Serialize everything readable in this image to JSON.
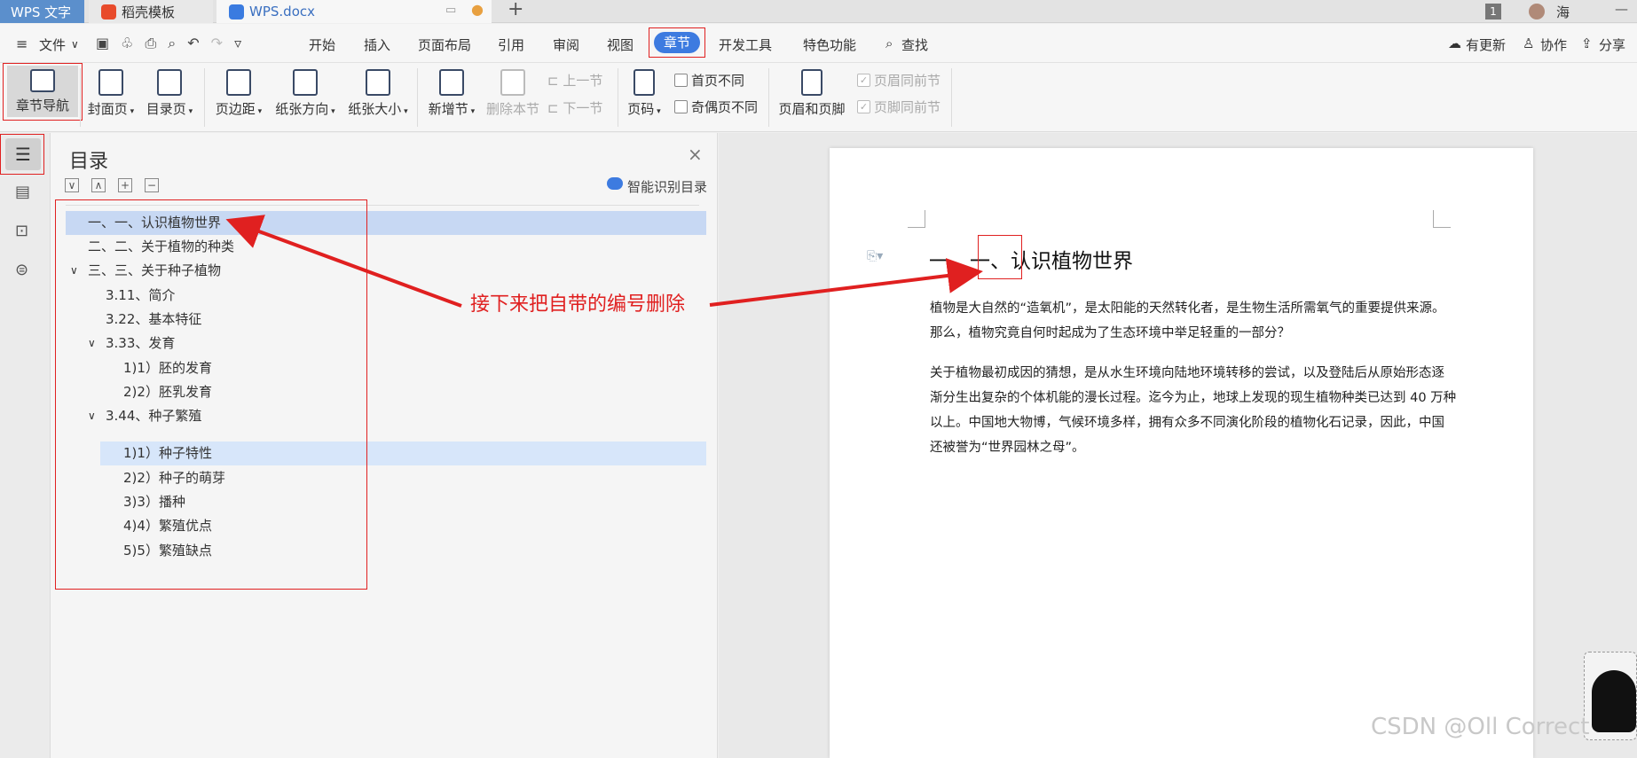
{
  "tabs": [
    {
      "label": "WPS 文字"
    },
    {
      "label": "稻壳模板"
    },
    {
      "label": "WPS.docx"
    }
  ],
  "titlebar": {
    "badge": "1",
    "user": "海"
  },
  "menu": {
    "file": "文件",
    "items": [
      "开始",
      "插入",
      "页面布局",
      "引用",
      "审阅",
      "视图",
      "章节",
      "开发工具",
      "特色功能"
    ],
    "search": "查找",
    "update": "有更新",
    "collab": "协作",
    "share": "分享"
  },
  "ribbon": {
    "nav": "章节导航",
    "cover": "封面页",
    "toc": "目录页",
    "margin": "页边距",
    "orient": "纸张方向",
    "size": "纸张大小",
    "newsec": "新增节",
    "delsec": "删除本节",
    "prev": "上一节",
    "next": "下一节",
    "pagenum": "页码",
    "firstdiff": "首页不同",
    "oddeven": "奇偶页不同",
    "headfoot": "页眉和页脚",
    "hsame": "页眉同前节",
    "fsame": "页脚同前节"
  },
  "toc": {
    "title": "目录",
    "smart": "智能识别目录",
    "items": [
      "一、一、认识植物世界",
      "二、二、关于植物的种类",
      "三、三、关于种子植物",
      "3.11、简介",
      "3.22、基本特征",
      "3.33、发育",
      "1)1）胚的发育",
      "2)2）胚乳发育",
      "3.44、种子繁殖",
      "1)1）种子特性",
      "2)2）种子的萌芽",
      "3)3）播种",
      "4)4）繁殖优点",
      "5)5）繁殖缺点"
    ]
  },
  "annotation": "接下来把自带的编号删除",
  "doc": {
    "heading": "一、一、认识植物世界",
    "para1a": "植物是大自然的“造氧机”，是太阳能的天然转化者，是生物生活所需氧气的重要提供来源。",
    "para1b": "那么，植物究竟自何时起成为了生态环境中举足轻重的一部分？",
    "para2a": "关于植物最初成因的猜想，是从水生环境向陆地环境转移的尝试，以及登陆后从原始形态逐",
    "para2b": "渐分生出复杂的个体机能的漫长过程。迄今为止，地球上发现的现生植物种类已达到 40 万种",
    "para2c": "以上。中国地大物博，气候环境多样，拥有众多不同演化阶段的植物化石记录，因此，中国",
    "para2d": "还被誉为“世界园林之母”。"
  },
  "watermark": "CSDN @Oll Correct",
  "colors": {
    "accent": "#3d7be0",
    "red": "#e02020"
  }
}
